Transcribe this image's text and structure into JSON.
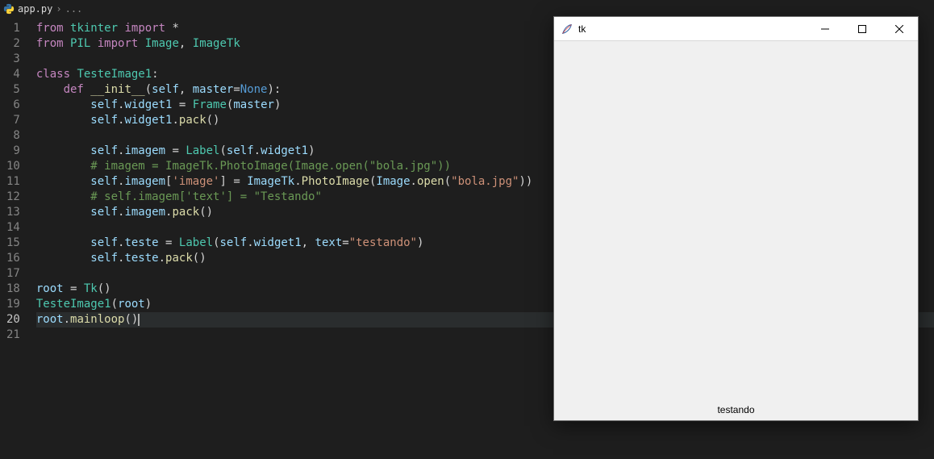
{
  "tab": {
    "filename": "app.py",
    "crumb_rest": "..."
  },
  "code": {
    "lines": [
      {
        "n": 1,
        "tokens": [
          [
            "kw",
            "from "
          ],
          [
            "cls",
            "tkinter"
          ],
          [
            "kw",
            " import "
          ],
          [
            "op",
            "*"
          ]
        ]
      },
      {
        "n": 2,
        "tokens": [
          [
            "kw",
            "from "
          ],
          [
            "cls",
            "PIL"
          ],
          [
            "kw",
            " import "
          ],
          [
            "cls",
            "Image"
          ],
          [
            "op",
            ", "
          ],
          [
            "cls",
            "ImageTk"
          ]
        ]
      },
      {
        "n": 3,
        "tokens": []
      },
      {
        "n": 4,
        "tokens": [
          [
            "kw",
            "class "
          ],
          [
            "cls",
            "TesteImage1"
          ],
          [
            "op",
            ":"
          ]
        ]
      },
      {
        "n": 5,
        "tokens": [
          [
            "op",
            "    "
          ],
          [
            "kw",
            "def "
          ],
          [
            "fn",
            "__init__"
          ],
          [
            "op",
            "("
          ],
          [
            "var",
            "self"
          ],
          [
            "op",
            ", "
          ],
          [
            "var",
            "master"
          ],
          [
            "op",
            "="
          ],
          [
            "const",
            "None"
          ],
          [
            "op",
            "):"
          ]
        ]
      },
      {
        "n": 6,
        "tokens": [
          [
            "op",
            "        "
          ],
          [
            "self",
            "self"
          ],
          [
            "op",
            "."
          ],
          [
            "var",
            "widget1"
          ],
          [
            "op",
            " = "
          ],
          [
            "cls",
            "Frame"
          ],
          [
            "op",
            "("
          ],
          [
            "var",
            "master"
          ],
          [
            "op",
            ")"
          ]
        ]
      },
      {
        "n": 7,
        "tokens": [
          [
            "op",
            "        "
          ],
          [
            "self",
            "self"
          ],
          [
            "op",
            "."
          ],
          [
            "var",
            "widget1"
          ],
          [
            "op",
            "."
          ],
          [
            "fn",
            "pack"
          ],
          [
            "op",
            "()"
          ]
        ]
      },
      {
        "n": 8,
        "tokens": []
      },
      {
        "n": 9,
        "tokens": [
          [
            "op",
            "        "
          ],
          [
            "self",
            "self"
          ],
          [
            "op",
            "."
          ],
          [
            "var",
            "imagem"
          ],
          [
            "op",
            " = "
          ],
          [
            "cls",
            "Label"
          ],
          [
            "op",
            "("
          ],
          [
            "self",
            "self"
          ],
          [
            "op",
            "."
          ],
          [
            "var",
            "widget1"
          ],
          [
            "op",
            ")"
          ]
        ]
      },
      {
        "n": 10,
        "tokens": [
          [
            "op",
            "        "
          ],
          [
            "cmt",
            "# imagem = ImageTk.PhotoImage(Image.open(\"bola.jpg\"))"
          ]
        ]
      },
      {
        "n": 11,
        "tokens": [
          [
            "op",
            "        "
          ],
          [
            "self",
            "self"
          ],
          [
            "op",
            "."
          ],
          [
            "var",
            "imagem"
          ],
          [
            "op",
            "["
          ],
          [
            "str",
            "'image'"
          ],
          [
            "op",
            "] = "
          ],
          [
            "var",
            "ImageTk"
          ],
          [
            "op",
            "."
          ],
          [
            "fn",
            "PhotoImage"
          ],
          [
            "op",
            "("
          ],
          [
            "var",
            "Image"
          ],
          [
            "op",
            "."
          ],
          [
            "fn",
            "open"
          ],
          [
            "op",
            "("
          ],
          [
            "str",
            "\"bola.jpg\""
          ],
          [
            "op",
            "))"
          ]
        ]
      },
      {
        "n": 12,
        "tokens": [
          [
            "op",
            "        "
          ],
          [
            "cmt",
            "# self.imagem['text'] = \"Testando\""
          ]
        ]
      },
      {
        "n": 13,
        "tokens": [
          [
            "op",
            "        "
          ],
          [
            "self",
            "self"
          ],
          [
            "op",
            "."
          ],
          [
            "var",
            "imagem"
          ],
          [
            "op",
            "."
          ],
          [
            "fn",
            "pack"
          ],
          [
            "op",
            "()"
          ]
        ]
      },
      {
        "n": 14,
        "tokens": []
      },
      {
        "n": 15,
        "tokens": [
          [
            "op",
            "        "
          ],
          [
            "self",
            "self"
          ],
          [
            "op",
            "."
          ],
          [
            "var",
            "teste"
          ],
          [
            "op",
            " = "
          ],
          [
            "cls",
            "Label"
          ],
          [
            "op",
            "("
          ],
          [
            "self",
            "self"
          ],
          [
            "op",
            "."
          ],
          [
            "var",
            "widget1"
          ],
          [
            "op",
            ", "
          ],
          [
            "var",
            "text"
          ],
          [
            "op",
            "="
          ],
          [
            "str",
            "\"testando\""
          ],
          [
            "op",
            ")"
          ]
        ]
      },
      {
        "n": 16,
        "tokens": [
          [
            "op",
            "        "
          ],
          [
            "self",
            "self"
          ],
          [
            "op",
            "."
          ],
          [
            "var",
            "teste"
          ],
          [
            "op",
            "."
          ],
          [
            "fn",
            "pack"
          ],
          [
            "op",
            "()"
          ]
        ]
      },
      {
        "n": 17,
        "tokens": []
      },
      {
        "n": 18,
        "tokens": [
          [
            "var",
            "root"
          ],
          [
            "op",
            " = "
          ],
          [
            "cls",
            "Tk"
          ],
          [
            "op",
            "()"
          ]
        ]
      },
      {
        "n": 19,
        "tokens": [
          [
            "cls",
            "TesteImage1"
          ],
          [
            "op",
            "("
          ],
          [
            "var",
            "root"
          ],
          [
            "op",
            ")"
          ]
        ]
      },
      {
        "n": 20,
        "active": true,
        "tokens": [
          [
            "var",
            "root"
          ],
          [
            "op",
            "."
          ],
          [
            "fn",
            "mainloop"
          ],
          [
            "op",
            "()"
          ]
        ]
      },
      {
        "n": 21,
        "tokens": []
      }
    ]
  },
  "tkwindow": {
    "title": "tk",
    "label_text": "testando"
  }
}
